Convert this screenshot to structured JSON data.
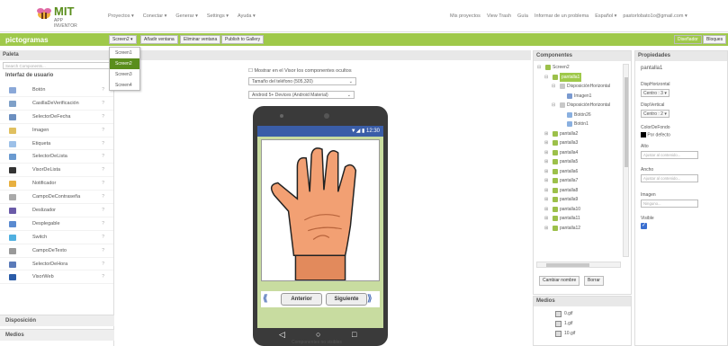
{
  "app": {
    "logo_main": "MIT",
    "logo_sub": "APP INVENTOR"
  },
  "topmenu": [
    "Proyectos ▾",
    "Conectar ▾",
    "Generar ▾",
    "Settings ▾",
    "Ayuda ▾"
  ],
  "topright": [
    "Mis proyectos",
    "View Trash",
    "Guía",
    "Informar de un problema",
    "Español ▾",
    "pastorlobato1o@gmail.com ▾"
  ],
  "toolbar": {
    "project": "pictogramas",
    "screen_btn": "Screen2 ▾",
    "add_screen": "Añadir ventana",
    "remove_screen": "Eliminar ventana",
    "publish": "Publish to Gallery",
    "designer": "Diseñador",
    "blocks": "Bloques"
  },
  "screen_menu": [
    "Screen1",
    "Screen2",
    "Screen3",
    "Screen4"
  ],
  "palette": {
    "title": "Paleta",
    "search_placeholder": "Search Components...",
    "group": "Interfaz de usuario",
    "items": [
      "Botón",
      "CasillaDeVerificación",
      "SelectorDeFecha",
      "Imagen",
      "Etiqueta",
      "SelectorDeLista",
      "VisorDeLista",
      "Notificador",
      "CampoDeContraseña",
      "Deslizador",
      "Desplegable",
      "Switch",
      "CampoDeTexto",
      "SelectorDeHora",
      "VisorWeb"
    ],
    "help": "?",
    "footer1": "Disposición",
    "footer2": "Medios"
  },
  "viewer": {
    "hidden_checkbox": "Mostrar en el Visor los componentes ocultos",
    "phone_size": "Tamaño del teléfono (505,320)",
    "theme": "Android 5+ Devices (Android Material)",
    "status_time": "12:30",
    "prev": "Anterior",
    "next": "Siguiente",
    "nonvisible": "Componentes no visibles"
  },
  "components": {
    "title": "Componentes",
    "tree": [
      {
        "label": "Screen2",
        "level": 0,
        "expander": "⊟"
      },
      {
        "label": "pantalla1",
        "level": 1,
        "expander": "⊟",
        "selected": true
      },
      {
        "label": "DisposiciónHorizontal",
        "level": 2,
        "expander": "⊟"
      },
      {
        "label": "Imagen1",
        "level": 3,
        "expander": ""
      },
      {
        "label": "DisposiciónHorizontal",
        "level": 2,
        "expander": "⊟"
      },
      {
        "label": "Botón26",
        "level": 3,
        "expander": ""
      },
      {
        "label": "Botón1",
        "level": 3,
        "expander": ""
      },
      {
        "label": "pantalla2",
        "level": 1,
        "expander": "⊞"
      },
      {
        "label": "pantalla3",
        "level": 1,
        "expander": "⊞"
      },
      {
        "label": "pantalla4",
        "level": 1,
        "expander": "⊞"
      },
      {
        "label": "pantalla5",
        "level": 1,
        "expander": "⊞"
      },
      {
        "label": "pantalla6",
        "level": 1,
        "expander": "⊞"
      },
      {
        "label": "pantalla7",
        "level": 1,
        "expander": "⊞"
      },
      {
        "label": "pantalla8",
        "level": 1,
        "expander": "⊞"
      },
      {
        "label": "pantalla9",
        "level": 1,
        "expander": "⊞"
      },
      {
        "label": "pantalla10",
        "level": 1,
        "expander": "⊞"
      },
      {
        "label": "pantalla11",
        "level": 1,
        "expander": "⊞"
      },
      {
        "label": "pantalla12",
        "level": 1,
        "expander": "⊞"
      }
    ],
    "rename": "Cambiar nombre",
    "delete": "Borrar"
  },
  "media": {
    "title": "Medios",
    "files": [
      "0.gif",
      "1.gif",
      "10.gif"
    ]
  },
  "properties": {
    "title": "Propiedades",
    "component": "pantalla1",
    "align_h_label": "DispHorizontal",
    "align_h_value": "Centro : 3 ▾",
    "align_v_label": "DispVertical",
    "align_v_value": "Centro : 2 ▾",
    "bg_label": "ColorDeFondo",
    "bg_value": "Por defecto",
    "height_label": "Alto",
    "height_placeholder": "Ajustar al contenido...",
    "width_label": "Ancho",
    "width_placeholder": "Ajustar al contenido...",
    "image_label": "Imagen",
    "image_placeholder": "Ninguno...",
    "visible_label": "Visible",
    "visible_checked": true
  },
  "colors": {
    "accent": "#9fc94a",
    "dark_accent": "#5a8e1c",
    "status": "#3a5da8"
  }
}
